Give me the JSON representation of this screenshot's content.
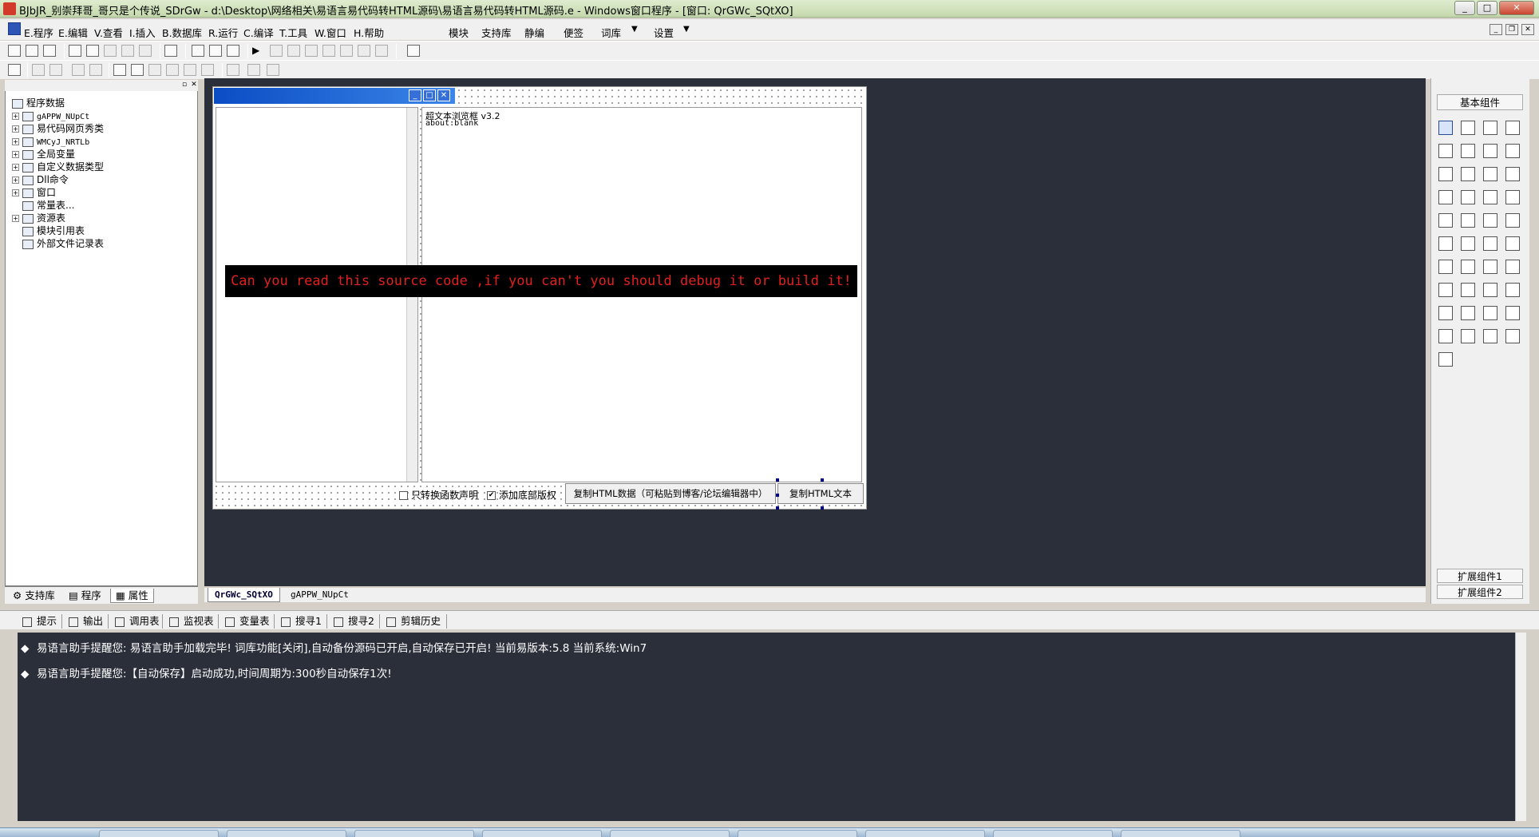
{
  "window": {
    "title": "BJbJR_别崇拜哥_哥只是个传说_SDrGw - d:\\Desktop\\网络相关\\易语言易代码转HTML源码\\易语言易代码转HTML源码.e - Windows窗口程序 - [窗口: QrGWc_SQtXO]"
  },
  "menu": {
    "items": [
      "E.程序",
      "E.编辑",
      "V.查看",
      "I.插入",
      "B.数据库",
      "R.运行",
      "C.编译",
      "T.工具",
      "W.窗口",
      "H.帮助",
      "模块",
      "支持库",
      "静编",
      "便签",
      "词库",
      "▼",
      "设置",
      "▼"
    ]
  },
  "left_panel": {
    "tree": [
      {
        "label": "程序数据",
        "expand": ""
      },
      {
        "label": "gAPPW_NUpCt",
        "expand": "+"
      },
      {
        "label": "易代码网页秀类",
        "expand": "+"
      },
      {
        "label": "WMCyJ_NRTLb",
        "expand": "+"
      },
      {
        "label": "全局变量",
        "expand": "+"
      },
      {
        "label": "自定义数据类型",
        "expand": "+"
      },
      {
        "label": "Dll命令",
        "expand": "+"
      },
      {
        "label": "窗口",
        "expand": "+"
      },
      {
        "label": "常量表...",
        "expand": ""
      },
      {
        "label": "资源表",
        "expand": "+"
      },
      {
        "label": "模块引用表",
        "expand": ""
      },
      {
        "label": "外部文件记录表",
        "expand": ""
      }
    ],
    "tabs": [
      "支持库",
      "程序",
      "属性"
    ]
  },
  "form": {
    "browser_title": "超文本浏览框 v3.2",
    "browser_url": "about:blank",
    "banner_text": "Can you read this source code ,if you can't you should debug it or build it!",
    "check_only_convert": "只转换函数声明",
    "check_add_copyright": "添加底部版权",
    "btn_copy_html_data": "复制HTML数据（可粘贴到博客/论坛编辑器中）",
    "btn_copy_html_text": "复制HTML文本"
  },
  "doc_tabs": [
    "QrGWc_SQtXO",
    "gAPPW_NUpCt"
  ],
  "right_panel": {
    "title": "基本组件",
    "footer1": "扩展组件1",
    "footer2": "扩展组件2"
  },
  "output_tabs": [
    "提示",
    "输出",
    "调用表",
    "监视表",
    "变量表",
    "搜寻1",
    "搜寻2",
    "剪辑历史"
  ],
  "output_lines": [
    "易语言助手提醒您:  易语言助手加载完毕!  词库功能[关闭],自动备份源码已开启,自动保存已开启!  当前易版本:5.8  当前系统:Win7",
    "易语言助手提醒您:【自动保存】启动成功,时间周期为:300秒自动保存1次!"
  ]
}
